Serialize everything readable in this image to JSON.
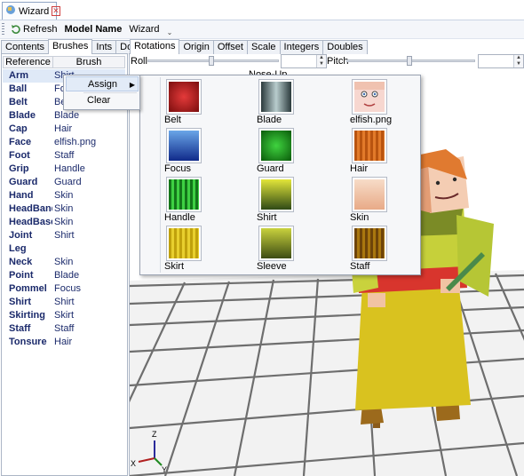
{
  "window": {
    "tab_title": "Wizard",
    "close_glyph": "✕"
  },
  "toolbar": {
    "refresh_label": "Refresh",
    "model_name_label": "Model Name",
    "model_name_value": "Wizard",
    "overflow_glyph": "⌄"
  },
  "left_tabs": [
    "Contents",
    "Brushes",
    "Ints",
    "Doubles"
  ],
  "left_active_tab": "Brushes",
  "right_tabs": [
    "Rotations",
    "Origin",
    "Offset",
    "Scale",
    "Integers",
    "Doubles"
  ],
  "right_active_tab": "Rotations",
  "rotations": {
    "roll_label": "Roll",
    "pitch_label": "Pitch",
    "nose_up_label": "Nose-Up"
  },
  "brush_table": {
    "columns": [
      "Reference",
      "Brush"
    ],
    "rows": [
      {
        "ref": "Arm",
        "brush": "Shirt"
      },
      {
        "ref": "Ball",
        "brush": "Focus"
      },
      {
        "ref": "Belt",
        "brush": "Belt"
      },
      {
        "ref": "Blade",
        "brush": "Blade"
      },
      {
        "ref": "Cap",
        "brush": "Hair"
      },
      {
        "ref": "Face",
        "brush": "elfish.png"
      },
      {
        "ref": "Foot",
        "brush": "Staff"
      },
      {
        "ref": "Grip",
        "brush": "Handle"
      },
      {
        "ref": "Guard",
        "brush": "Guard"
      },
      {
        "ref": "Hand",
        "brush": "Skin"
      },
      {
        "ref": "HeadBand",
        "brush": "Skin"
      },
      {
        "ref": "HeadBase",
        "brush": "Skin"
      },
      {
        "ref": "Joint",
        "brush": "Shirt"
      },
      {
        "ref": "Leg",
        "brush": ""
      },
      {
        "ref": "Neck",
        "brush": "Skin"
      },
      {
        "ref": "Point",
        "brush": "Blade"
      },
      {
        "ref": "Pommel",
        "brush": "Focus"
      },
      {
        "ref": "Shirt",
        "brush": "Shirt"
      },
      {
        "ref": "Skirting",
        "brush": "Skirt"
      },
      {
        "ref": "Staff",
        "brush": "Staff"
      },
      {
        "ref": "Tonsure",
        "brush": "Hair"
      }
    ]
  },
  "context_menu": {
    "assign_label": "Assign",
    "clear_label": "Clear",
    "submenu_arrow": "▶"
  },
  "brush_palette": [
    {
      "name": "Belt",
      "icon": "red-swatch",
      "colors": [
        "#7a0d0d",
        "#e43a3a"
      ],
      "pattern": "flat"
    },
    {
      "name": "Blade",
      "icon": "steel-swatch",
      "colors": [
        "#2b3a3c",
        "#b8cccd"
      ],
      "pattern": "h"
    },
    {
      "name": "elfish.png",
      "icon": "face-swatch",
      "colors": [
        "#f7d7d0",
        "#f7d7d0"
      ],
      "pattern": "face"
    },
    {
      "name": "Focus",
      "icon": "blue-swatch",
      "colors": [
        "#102a8a",
        "#6aa6e8"
      ],
      "pattern": "v"
    },
    {
      "name": "Guard",
      "icon": "green-swatch",
      "colors": [
        "#0a5a0a",
        "#3fd33f"
      ],
      "pattern": "flat"
    },
    {
      "name": "Hair",
      "icon": "orange-swatch",
      "colors": [
        "#b95410",
        "#e27a2a"
      ],
      "pattern": "stripes"
    },
    {
      "name": "Handle",
      "icon": "green-stripe-swatch",
      "colors": [
        "#13761a",
        "#3ed043"
      ],
      "pattern": "stripes"
    },
    {
      "name": "Shirt",
      "icon": "yellow-green-swatch",
      "colors": [
        "#2f4a16",
        "#e3e63a"
      ],
      "pattern": "v"
    },
    {
      "name": "Skin",
      "icon": "skin-swatch",
      "colors": [
        "#e8aa87",
        "#f7dcc8"
      ],
      "pattern": "v"
    },
    {
      "name": "Skirt",
      "icon": "yellow-swatch",
      "colors": [
        "#c0a10c",
        "#e8cf2e"
      ],
      "pattern": "stripes"
    },
    {
      "name": "Sleeve",
      "icon": "olive-swatch",
      "colors": [
        "#3d4c13",
        "#c9d23d"
      ],
      "pattern": "v"
    },
    {
      "name": "Staff",
      "icon": "brown-swatch",
      "colors": [
        "#6e4409",
        "#a9770f"
      ],
      "pattern": "stripes"
    }
  ],
  "axes_gizmo": {
    "z": "Z",
    "x": "X",
    "y": "Y"
  }
}
